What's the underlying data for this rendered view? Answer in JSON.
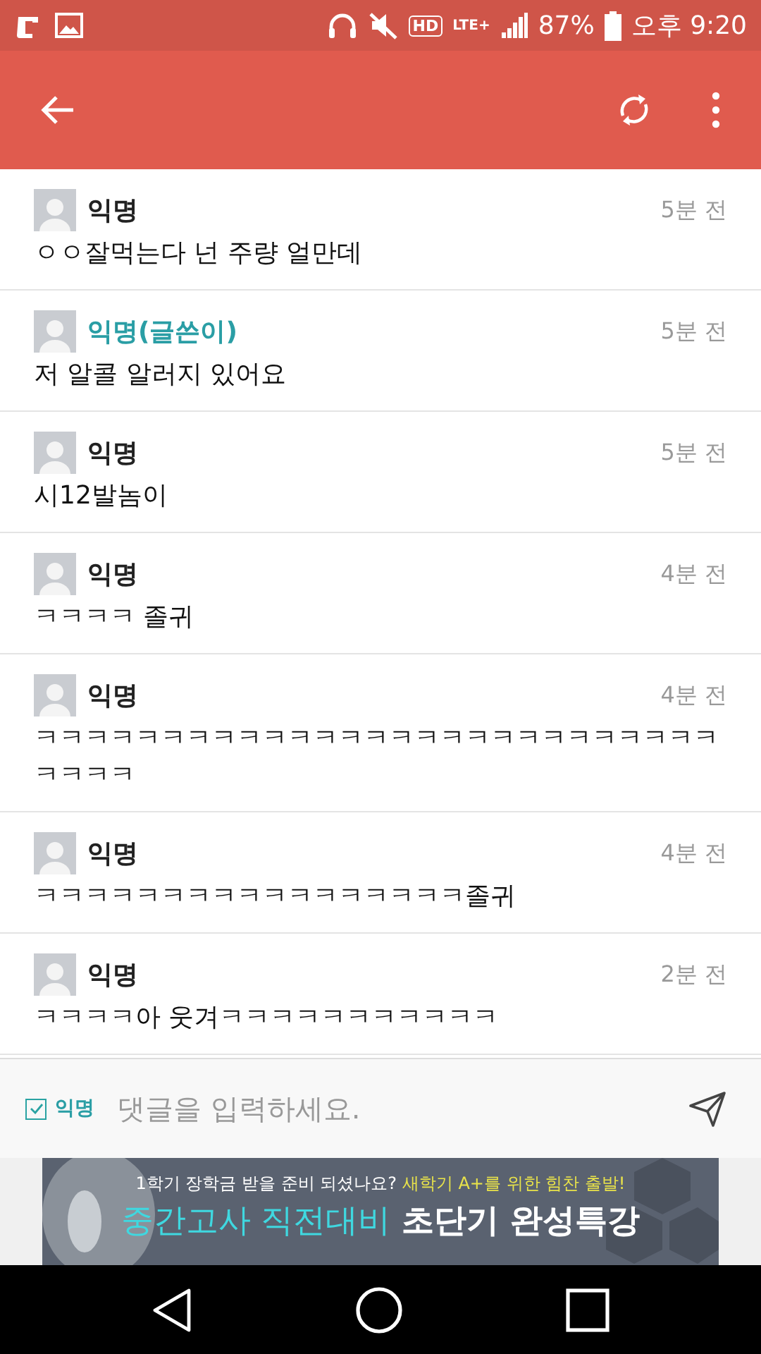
{
  "status_bar": {
    "network": "LTE+",
    "hd": "HD",
    "battery": "87%",
    "time": "오후 9:20"
  },
  "comments": [
    {
      "author": "익명",
      "is_writer": false,
      "time": "5분 전",
      "text": "ㅇㅇ잘먹는다 넌 주량 얼만데"
    },
    {
      "author": "익명(글쓴이)",
      "is_writer": true,
      "time": "5분 전",
      "text": "저 알콜 알러지 있어요"
    },
    {
      "author": "익명",
      "is_writer": false,
      "time": "5분 전",
      "text": "시12발놈이"
    },
    {
      "author": "익명",
      "is_writer": false,
      "time": "4분 전",
      "text": "ㅋㅋㅋㅋ 졸귀"
    },
    {
      "author": "익명",
      "is_writer": false,
      "time": "4분 전",
      "text": "ㅋㅋㅋㅋㅋㅋㅋㅋㅋㅋㅋㅋㅋㅋㅋㅋㅋㅋㅋㅋㅋㅋㅋㅋㅋㅋㅋㅋㅋㅋㅋ"
    },
    {
      "author": "익명",
      "is_writer": false,
      "time": "4분 전",
      "text": "ㅋㅋㅋㅋㅋㅋㅋㅋㅋㅋㅋㅋㅋㅋㅋㅋㅋ졸귀"
    },
    {
      "author": "익명",
      "is_writer": false,
      "time": "2분 전",
      "text": "ㅋㅋㅋㅋ아 웃겨ㅋㅋㅋㅋㅋㅋㅋㅋㅋㅋㅋ"
    }
  ],
  "composer": {
    "anonymous_label": "익명",
    "anonymous_checked": true,
    "placeholder": "댓글을 입력하세요."
  },
  "ad": {
    "line_1": "1학기 장학금 받을 준비 되셨나요?",
    "line_1_highlight": "새학기 A+를 위한 힘찬 출발!",
    "headline": "중간고사 직전대비",
    "headline_strong": "초단기 완성특강"
  }
}
